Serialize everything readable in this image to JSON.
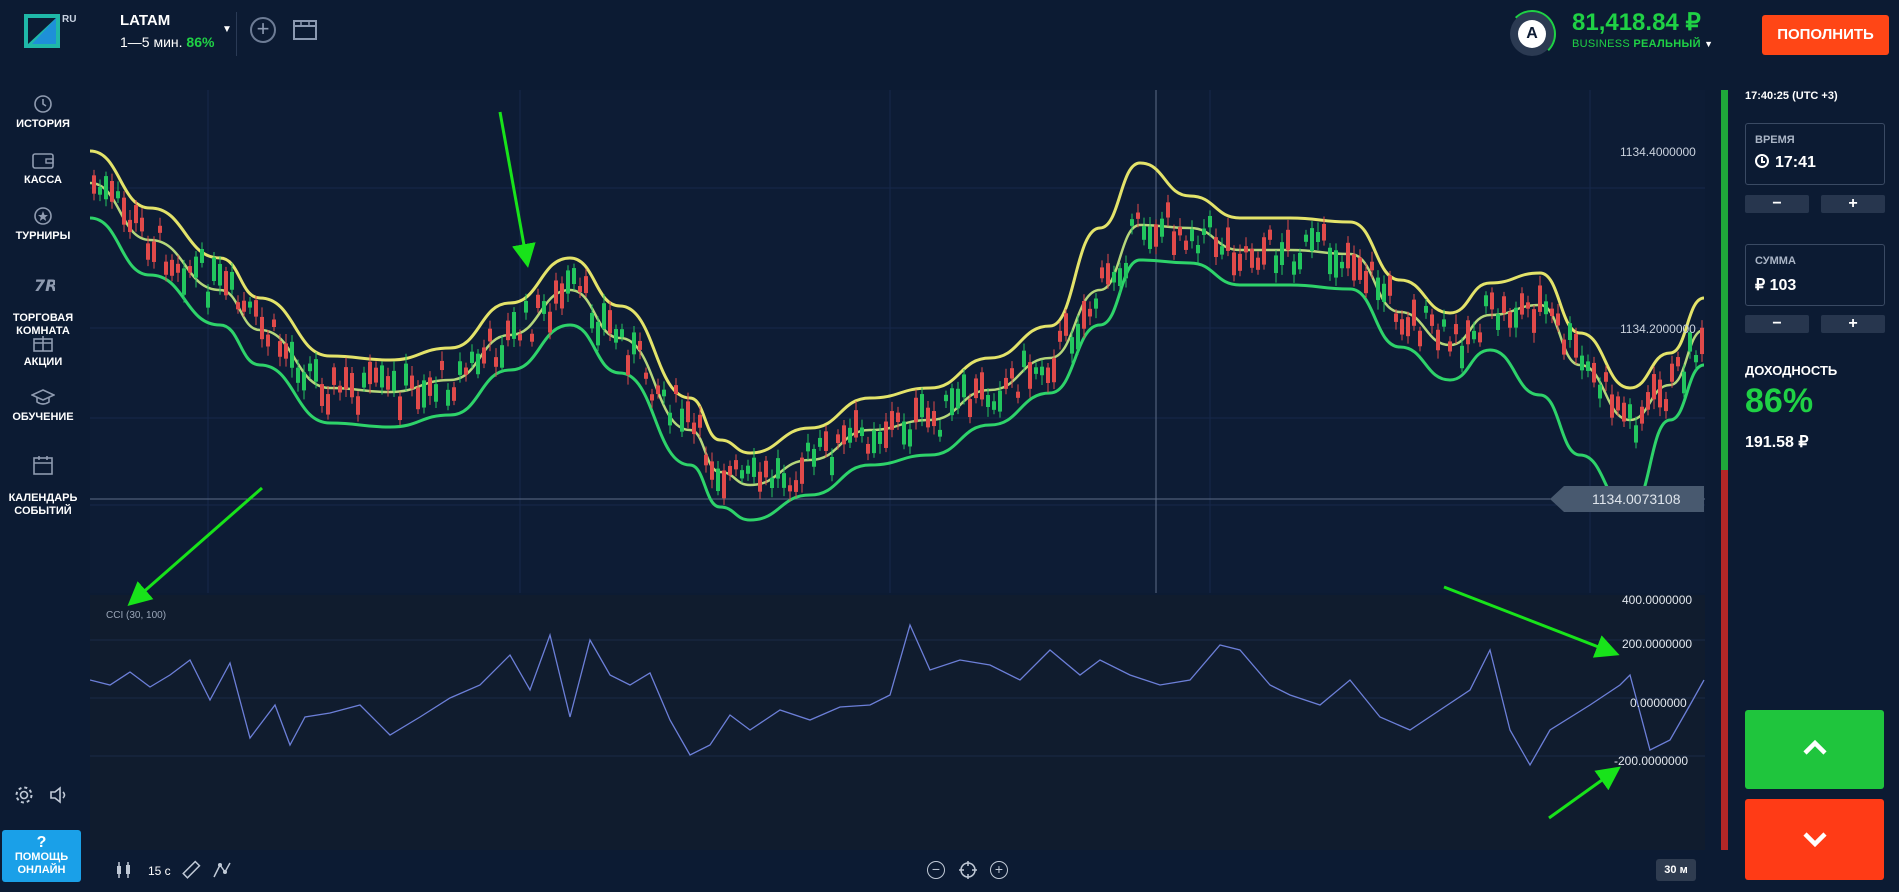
{
  "header": {
    "logo_suffix": "RU",
    "asset_name": "LATAM",
    "asset_expiry": "1—5 мин.",
    "asset_payout": "86%",
    "balance": "81,418.84 ₽",
    "account_type": "BUSINESS",
    "account_mode": "РЕАЛЬНЫЙ",
    "avatar_letter": "A",
    "deposit_label": "ПОПОЛНИТЬ"
  },
  "sidebar": {
    "items": [
      {
        "label": "ИСТОРИЯ",
        "icon": "history-icon"
      },
      {
        "label": "КАССА",
        "icon": "wallet-icon"
      },
      {
        "label": "ТУРНИРЫ",
        "icon": "star-icon"
      },
      {
        "label": "ТОРГОВАЯ\nКОМНАТА",
        "icon": "trading-room-icon"
      },
      {
        "label": "АКЦИИ",
        "icon": "gift-icon"
      },
      {
        "label": "ОБУЧЕНИЕ",
        "icon": "graduation-cap-icon"
      },
      {
        "label": "КАЛЕНДАРЬ\nСОБЫТИЙ",
        "icon": "calendar-icon"
      }
    ],
    "help_label": "ПОМОЩЬ\nОНЛАЙН",
    "help_symbol": "?"
  },
  "chart": {
    "price_labels": [
      "1134.4000000",
      "1134.2000000"
    ],
    "current_price": "1134.0073108",
    "cci_title": "CCI (30, 100)",
    "cci_labels": [
      "400.0000000",
      "200.0000000",
      "0.0000000",
      "-200.0000000"
    ],
    "colors": {
      "bullish": "#22c55e",
      "bearish": "#e04a4a",
      "band_upper": "#e3e36a",
      "band_middle": "#b5d67a",
      "band_lower": "#2ed36a",
      "cci_line": "#6c7fd8",
      "annotation_arrow": "#18e31a"
    }
  },
  "toolbar": {
    "timeframe": "15 с",
    "period": "30 м"
  },
  "right_panel": {
    "clock": "17:40:25 (UTC +3)",
    "time_label": "ВРЕМЯ",
    "time_value": "17:41",
    "amount_label": "СУММА",
    "amount_value": "₽ 103",
    "minus": "−",
    "plus": "+",
    "yield_label": "ДОХОДНОСТЬ",
    "yield_percent": "86%",
    "yield_amount": "191.58 ₽",
    "sentiment_up_fraction": 0.5
  }
}
